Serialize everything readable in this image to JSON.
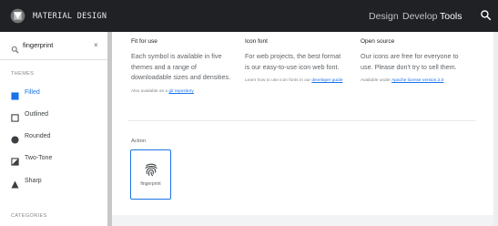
{
  "header": {
    "brand": "MATERIAL DESIGN",
    "nav": {
      "design": "Design",
      "develop": "Develop",
      "tools": "Tools"
    }
  },
  "sidebar": {
    "search_value": "fingerprint",
    "clear": "×",
    "themes_label": "THEMES",
    "themes": [
      {
        "label": "Filled",
        "icon": "filled-square-icon"
      },
      {
        "label": "Outlined",
        "icon": "outlined-square-icon"
      },
      {
        "label": "Rounded",
        "icon": "rounded-circle-icon"
      },
      {
        "label": "Two-Tone",
        "icon": "two-tone-square-icon"
      },
      {
        "label": "Sharp",
        "icon": "sharp-triangle-icon"
      }
    ],
    "categories_label": "CATEGORIES"
  },
  "info": {
    "fit": {
      "title": "Fit for use",
      "desc": "Each symbol is available in five themes and a range of downloadable sizes and densities.",
      "note_prefix": "Also available as a ",
      "note_link": "git repository"
    },
    "font": {
      "title": "Icon font",
      "desc": "For web projects, the best format is our easy-to-use icon web font.",
      "note_prefix": "Learn how to use icon fonts in our ",
      "note_link": "developer guide"
    },
    "open": {
      "title": "Open source",
      "desc": "Our icons are free for everyone to use. Please don't try to sell them.",
      "note_prefix": "Available under ",
      "note_link": "Apache license version 2.0"
    }
  },
  "results": {
    "category": "Action",
    "icons": [
      {
        "label": "fingerprint",
        "icon": "fingerprint-icon"
      }
    ]
  },
  "colors": {
    "topbar": "#202124",
    "accent": "#1a73e8"
  }
}
